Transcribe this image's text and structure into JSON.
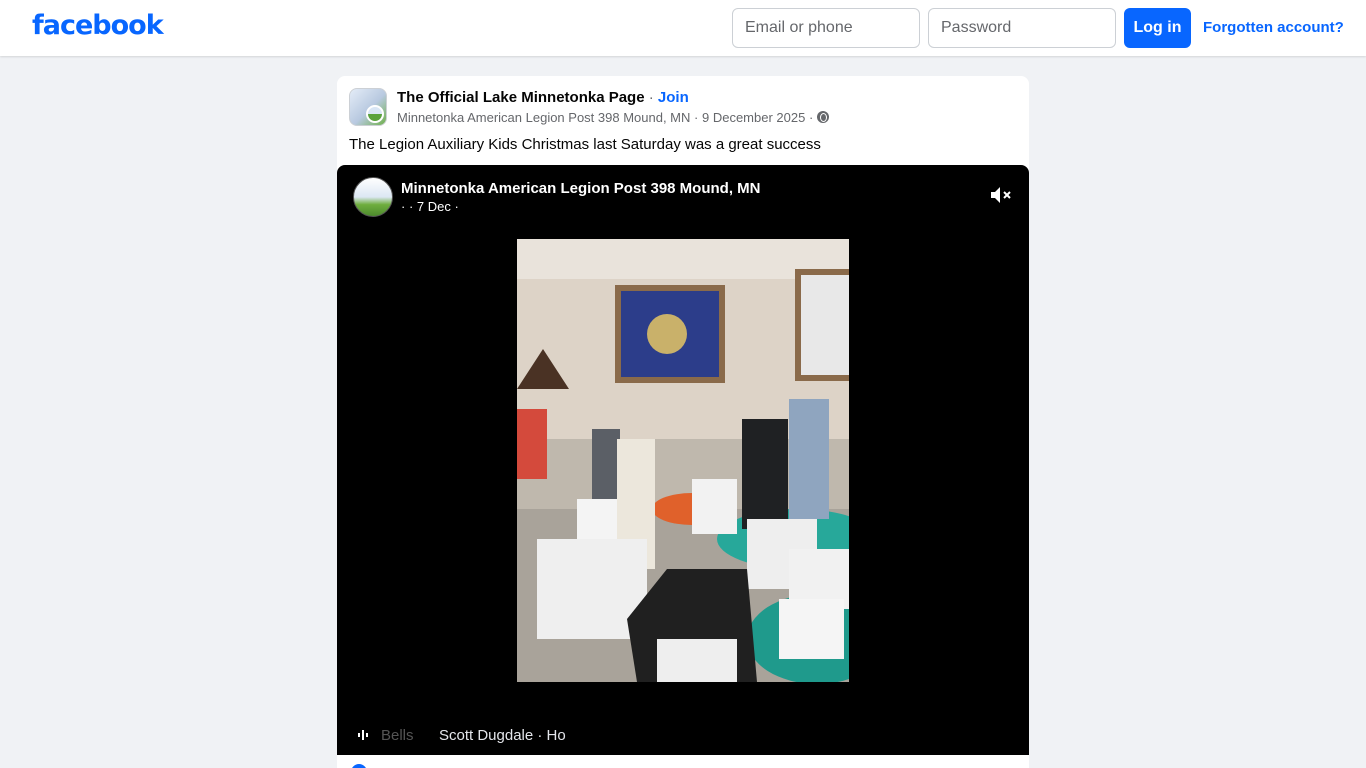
{
  "header": {
    "logo": "facebook",
    "email_placeholder": "Email or phone",
    "password_placeholder": "Password",
    "login_label": "Log in",
    "forgot_label": "Forgotten account?"
  },
  "post": {
    "page_name": "The Official Lake Minnetonka Page",
    "separator": "·",
    "join_label": "Join",
    "author": "Minnetonka American Legion Post 398 Mound, MN",
    "date": "9 December 2025",
    "meta_separator": "·",
    "caption": "The Legion Auxiliary Kids Christmas last Saturday was a great success"
  },
  "video": {
    "author": "Minnetonka American Legion Post 398 Mound, MN",
    "date_line": "· · 7 Dec ·",
    "song_faded": "Bells",
    "song_artist": "Scott Dugdale · Ho"
  },
  "colors": {
    "brand": "#0866ff",
    "background": "#f0f2f5",
    "text_secondary": "#65676b"
  },
  "icons": [
    "mute-icon",
    "globe-icon",
    "music-bars-icon"
  ]
}
